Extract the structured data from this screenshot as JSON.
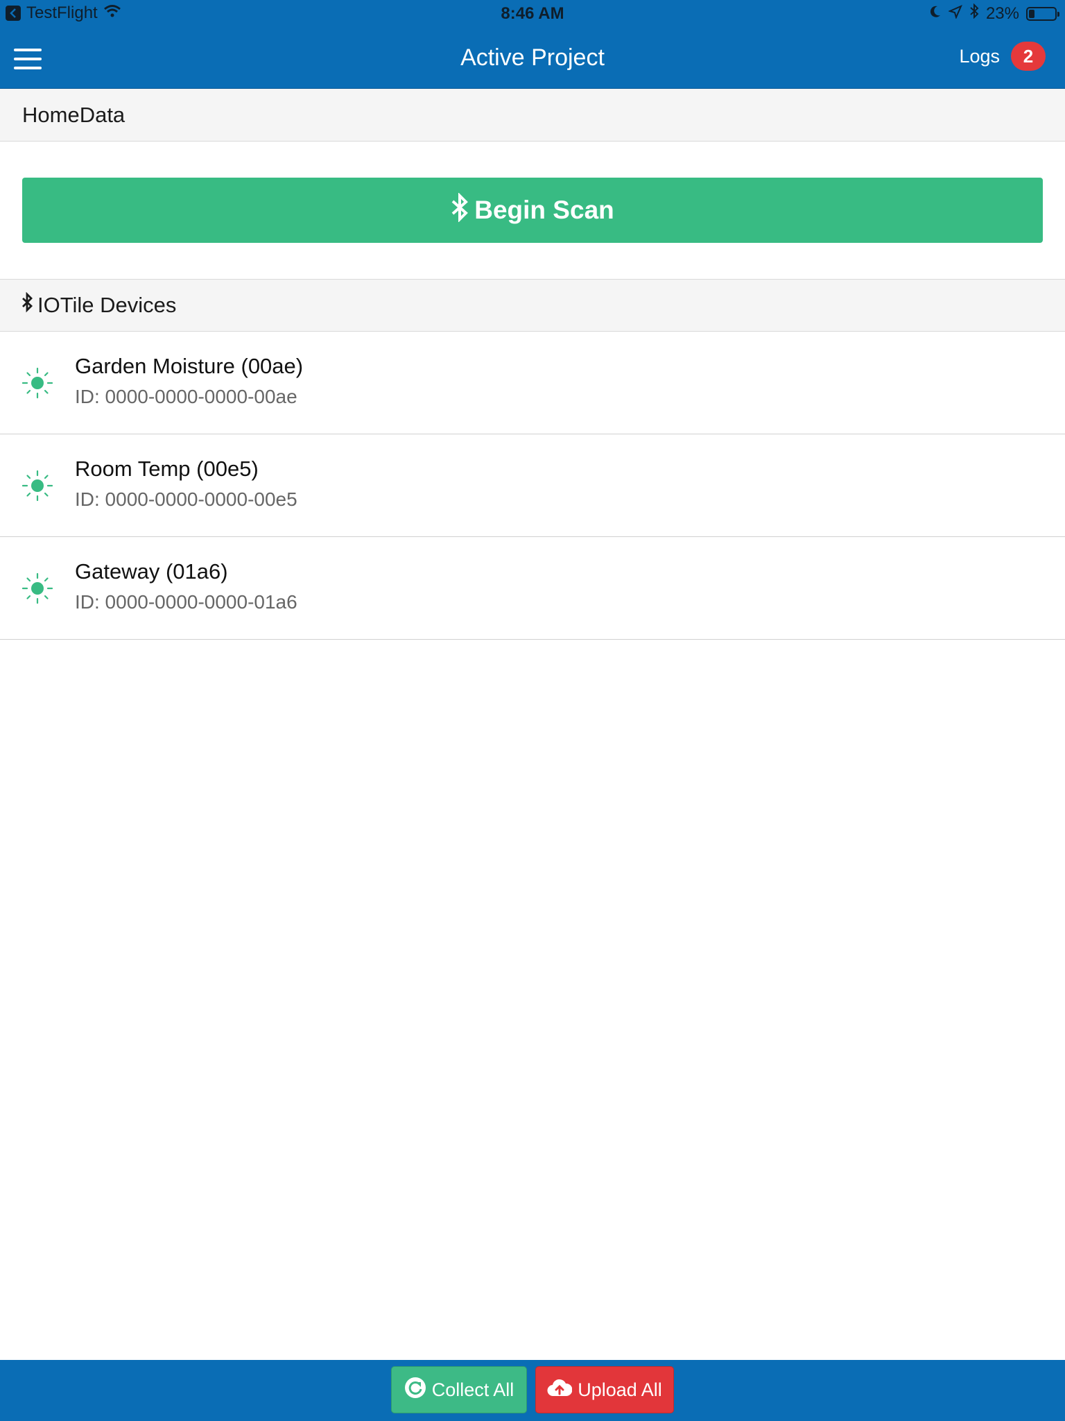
{
  "status_bar": {
    "back_app": "TestFlight",
    "time": "8:46 AM",
    "battery": "23%",
    "battery_level": 0.23
  },
  "nav": {
    "title": "Active Project",
    "logs_label": "Logs",
    "logs_count": "2"
  },
  "project": {
    "name": "HomeData"
  },
  "scan": {
    "label": "Begin Scan"
  },
  "devices_section": {
    "title": "IOTile Devices"
  },
  "devices": [
    {
      "name": "Garden Moisture (00ae)",
      "id": "ID: 0000-0000-0000-00ae"
    },
    {
      "name": "Room Temp (00e5)",
      "id": "ID: 0000-0000-0000-00e5"
    },
    {
      "name": "Gateway (01a6)",
      "id": "ID: 0000-0000-0000-01a6"
    }
  ],
  "footer": {
    "collect_label": "Collect All",
    "upload_label": "Upload All"
  },
  "colors": {
    "primary": "#0a6db5",
    "success": "#38bb83",
    "danger": "#e2363a",
    "device_icon": "#38bb83"
  },
  "icons": {
    "menu": "hamburger-icon",
    "scan": "bluetooth-icon",
    "device": "sun-icon",
    "collect": "refresh-icon",
    "upload": "cloud-upload-icon"
  }
}
